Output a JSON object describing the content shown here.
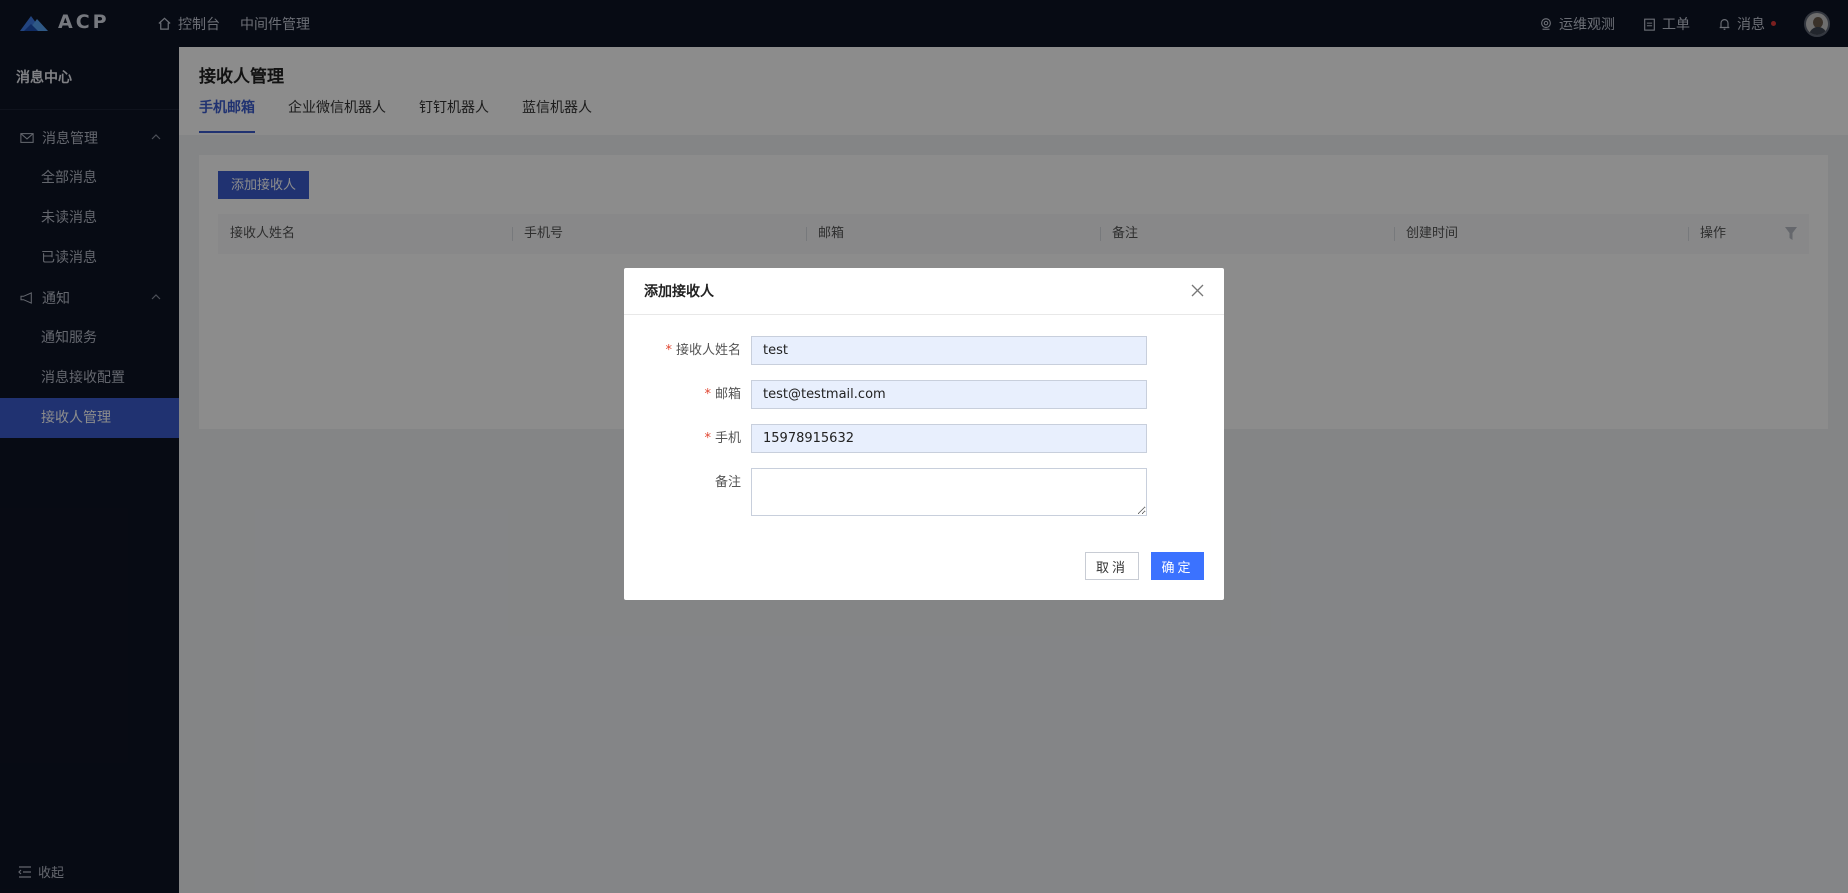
{
  "brand": {
    "name": "ACP"
  },
  "topnav": {
    "items": [
      {
        "label": "控制台",
        "icon": "home-icon"
      },
      {
        "label": "中间件管理"
      }
    ]
  },
  "topright": {
    "ops": "运维观测",
    "ticket": "工单",
    "messages": "消息",
    "message_dot_color": "#e03a3a"
  },
  "sidebar": {
    "title": "消息中心",
    "groups": [
      {
        "label": "消息管理",
        "icon": "mail-icon",
        "items": [
          "全部消息",
          "未读消息",
          "已读消息"
        ]
      },
      {
        "label": "通知",
        "icon": "megaphone-icon",
        "items": [
          "通知服务",
          "消息接收配置",
          "接收人管理"
        ]
      }
    ],
    "active_item": "接收人管理",
    "collapse": "收起",
    "active_color": "#3b5cce"
  },
  "page": {
    "title": "接收人管理",
    "tabs": [
      "手机邮箱",
      "企业微信机器人",
      "钉钉机器人",
      "蓝信机器人"
    ],
    "active_tab": "手机邮箱",
    "add_button": "添加接收人",
    "columns": [
      "接收人姓名",
      "手机号",
      "邮箱",
      "备注",
      "创建时间",
      "操作"
    ]
  },
  "modal": {
    "title": "添加接收人",
    "fields": {
      "name": {
        "label": "接收人姓名",
        "required": true,
        "value": "test"
      },
      "email": {
        "label": "邮箱",
        "required": true,
        "value": "test@testmail.com"
      },
      "phone": {
        "label": "手机",
        "required": true,
        "value": "15978915632"
      },
      "remark": {
        "label": "备注",
        "required": false,
        "value": ""
      }
    },
    "required_mark": "*",
    "cancel": "取消",
    "ok": "确定",
    "ok_color": "#3b72ff"
  }
}
